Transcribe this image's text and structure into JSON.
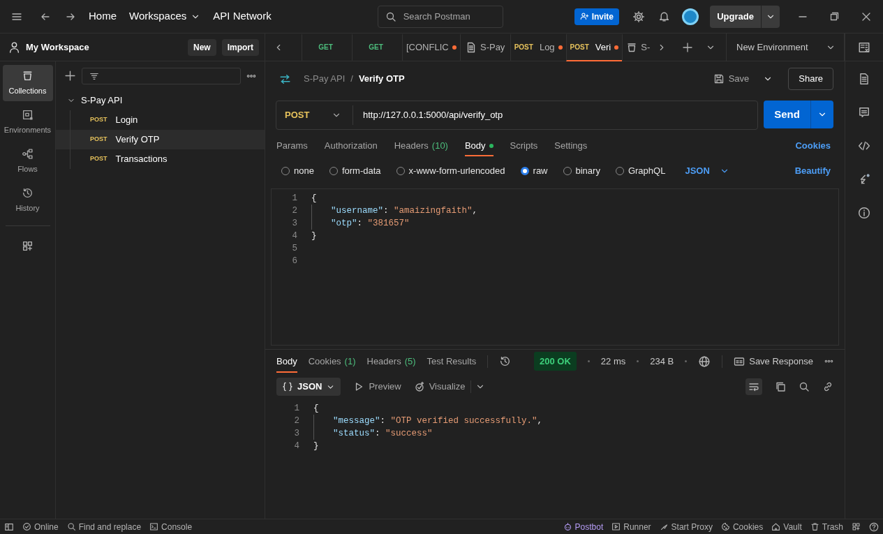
{
  "topbar": {
    "nav": [
      {
        "label": "Home",
        "dropdown": false
      },
      {
        "label": "Workspaces",
        "dropdown": true
      },
      {
        "label": "API Network",
        "dropdown": false
      }
    ],
    "search": {
      "placeholder": "Search Postman"
    },
    "invite": "Invite",
    "upgrade": "Upgrade"
  },
  "workspace": {
    "title": "My Workspace",
    "buttons": [
      "New",
      "Import"
    ]
  },
  "rail": [
    {
      "label": "Collections",
      "selected": true
    },
    {
      "label": "Environments",
      "selected": false
    },
    {
      "label": "Flows",
      "selected": false
    },
    {
      "label": "History",
      "selected": false
    }
  ],
  "collection": {
    "name": "S-Pay API",
    "expanded": true,
    "children": [
      {
        "method": "POST",
        "name": "Login",
        "selected": false
      },
      {
        "method": "POST",
        "name": "Verify OTP",
        "selected": true
      },
      {
        "method": "POST",
        "name": "Transactions",
        "selected": false
      }
    ]
  },
  "tabs": [
    {
      "kind": "request",
      "method": "GET",
      "unsaved": false,
      "selected": false
    },
    {
      "kind": "request",
      "method": "GET",
      "unsaved": false,
      "selected": false
    },
    {
      "kind": "request",
      "label": "[CONFLIC",
      "unsaved": true,
      "selected": false
    },
    {
      "kind": "document",
      "label": "S-Pay",
      "unsaved": false,
      "selected": false
    },
    {
      "kind": "request",
      "method": "POST",
      "label": "Log",
      "unsaved": true,
      "selected": false
    },
    {
      "kind": "request",
      "method": "POST",
      "label": "Veri",
      "unsaved": true,
      "selected": true
    },
    {
      "kind": "collection",
      "label": "S-",
      "unsaved": false,
      "selected": false
    }
  ],
  "environment": "New Environment",
  "request": {
    "breadcrumb": [
      "S-Pay API",
      "Verify OTP"
    ],
    "separator": "/",
    "save": "Save",
    "share": "Share",
    "method": "POST",
    "url": "http://127.0.0.1:5000/api/verify_otp",
    "send": "Send",
    "tabs": [
      {
        "label": "Params",
        "selected": false
      },
      {
        "label": "Authorization",
        "selected": false
      },
      {
        "label": "Headers",
        "count": "(10)",
        "selected": false
      },
      {
        "label": "Body",
        "selected": true,
        "dot": true
      },
      {
        "label": "Scripts",
        "selected": false
      },
      {
        "label": "Settings",
        "selected": false
      }
    ],
    "cookies": "Cookies",
    "body_types": [
      {
        "label": "none",
        "selected": false
      },
      {
        "label": "form-data",
        "selected": false
      },
      {
        "label": "x-www-form-urlencoded",
        "selected": false
      },
      {
        "label": "raw",
        "selected": true
      },
      {
        "label": "binary",
        "selected": false
      },
      {
        "label": "GraphQL",
        "selected": false
      }
    ],
    "format": "JSON",
    "beautify": "Beautify",
    "lines": [
      {
        "number": "1",
        "indented": false,
        "parts": [
          {
            "kind": "punct",
            "text": "{"
          }
        ]
      },
      {
        "number": "2",
        "indented": true,
        "parts": [
          {
            "kind": "key",
            "text": "\"username\""
          },
          {
            "kind": "punct",
            "text": ": "
          },
          {
            "kind": "string",
            "text": "\"amaizingfaith\""
          },
          {
            "kind": "punct",
            "text": ","
          }
        ]
      },
      {
        "number": "3",
        "indented": true,
        "parts": [
          {
            "kind": "key",
            "text": "\"otp\""
          },
          {
            "kind": "punct",
            "text": ": "
          },
          {
            "kind": "string",
            "text": "\"381657\""
          }
        ]
      },
      {
        "number": "4",
        "indented": false,
        "parts": [
          {
            "kind": "punct",
            "text": "}"
          }
        ]
      },
      {
        "number": "5"
      },
      {
        "number": "6"
      }
    ]
  },
  "response": {
    "tabs": [
      {
        "label": "Body",
        "selected": true
      },
      {
        "label": "Cookies",
        "count": "(1)",
        "selected": false
      },
      {
        "label": "Headers",
        "count": "(5)",
        "selected": false
      },
      {
        "label": "Test Results",
        "selected": false
      }
    ],
    "status": "200 OK",
    "time": "22 ms",
    "size": "234 B",
    "save": "Save Response",
    "view": "JSON",
    "views": [
      "Preview",
      "Visualize"
    ],
    "lines": [
      {
        "number": "1",
        "indented": false,
        "parts": [
          {
            "kind": "punct",
            "text": "{"
          }
        ]
      },
      {
        "number": "2",
        "indented": true,
        "parts": [
          {
            "kind": "key",
            "text": "\"message\""
          },
          {
            "kind": "punct",
            "text": ": "
          },
          {
            "kind": "string",
            "text": "\"OTP verified successfully.\""
          },
          {
            "kind": "punct",
            "text": ","
          }
        ]
      },
      {
        "number": "3",
        "indented": true,
        "parts": [
          {
            "kind": "key",
            "text": "\"status\""
          },
          {
            "kind": "punct",
            "text": ": "
          },
          {
            "kind": "string",
            "text": "\"success\""
          }
        ]
      },
      {
        "number": "4",
        "indented": false,
        "parts": [
          {
            "kind": "punct",
            "text": "}"
          }
        ]
      }
    ]
  },
  "status_bar": {
    "left": [
      "Online",
      "Find and replace",
      "Console"
    ],
    "right": [
      {
        "label": "Postbot",
        "highlighted": true
      },
      {
        "label": "Runner",
        "highlighted": false
      },
      {
        "label": "Start Proxy",
        "highlighted": false
      },
      {
        "label": "Cookies",
        "highlighted": false
      },
      {
        "label": "Vault",
        "highlighted": false
      },
      {
        "label": "Trash",
        "highlighted": false
      }
    ]
  }
}
